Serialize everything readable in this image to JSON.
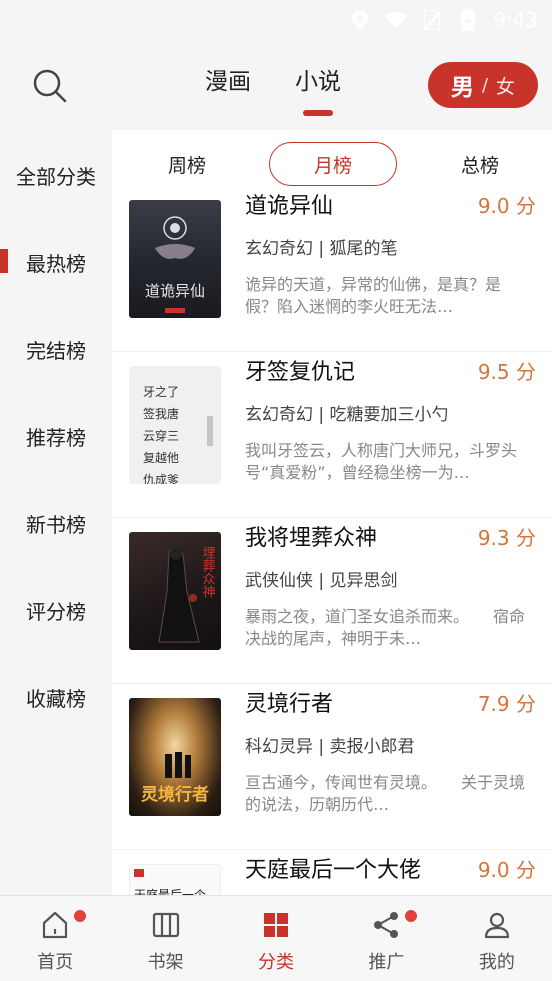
{
  "status_bar": {
    "time": "9:43"
  },
  "top_tabs": [
    {
      "label": "漫画",
      "active": false
    },
    {
      "label": "小说",
      "active": true
    }
  ],
  "gender": {
    "male": "男",
    "separator": "/",
    "female": "女"
  },
  "sidebar": {
    "items": [
      {
        "label": "全部分类",
        "active": false
      },
      {
        "label": "最热榜",
        "active": true
      },
      {
        "label": "完结榜",
        "active": false
      },
      {
        "label": "推荐榜",
        "active": false
      },
      {
        "label": "新书榜",
        "active": false
      },
      {
        "label": "评分榜",
        "active": false
      },
      {
        "label": "收藏榜",
        "active": false
      }
    ]
  },
  "sub_tabs": [
    {
      "label": "周榜",
      "active": false
    },
    {
      "label": "月榜",
      "active": true
    },
    {
      "label": "总榜",
      "active": false
    }
  ],
  "books": [
    {
      "title": "道诡异仙",
      "score": "9.0 分",
      "meta": "玄幻奇幻 | 狐尾的笔",
      "desc": "诡异的天道，异常的仙佛，是真？是假？陷入迷惘的李火旺无法…",
      "cover_text": "道诡异仙"
    },
    {
      "title": "牙签复仇记",
      "score": "9.5 分",
      "meta": "玄幻奇幻 | 吃糖要加三小勺",
      "desc": "我叫牙签云，人称唐门大师兄，斗罗头号“真爱粉”，曾经稳坐榜一为…",
      "cover_text": "牙之了签我唐云穿三复越他仇成爹"
    },
    {
      "title": "我将埋葬众神",
      "score": "9.3 分",
      "meta": "武侠仙侠 | 见异思剑",
      "desc": "暴雨之夜，道门圣女追杀而来。　　宿命决战的尾声，神明于未…",
      "cover_text": "埋葬众神"
    },
    {
      "title": "灵境行者",
      "score": "7.9 分",
      "meta": "科幻灵异 | 卖报小郎君",
      "desc": "亘古通今，传闻世有灵境。　　关于灵境的说法，历朝历代…",
      "cover_text": "灵境行者"
    },
    {
      "title": "天庭最后一个大佬",
      "score": "9.0 分",
      "meta": "",
      "desc": "",
      "cover_text": "天庭最后一个"
    }
  ],
  "bottom_nav": [
    {
      "label": "首页",
      "icon": "home-icon",
      "active": false,
      "badge": true
    },
    {
      "label": "书架",
      "icon": "bookshelf-icon",
      "active": false,
      "badge": false
    },
    {
      "label": "分类",
      "icon": "category-icon",
      "active": true,
      "badge": false
    },
    {
      "label": "推广",
      "icon": "share-icon",
      "active": false,
      "badge": true
    },
    {
      "label": "我的",
      "icon": "profile-icon",
      "active": false,
      "badge": false
    }
  ],
  "colors": {
    "accent": "#c8342a",
    "score": "#d4763b",
    "badge": "#e0413a"
  }
}
